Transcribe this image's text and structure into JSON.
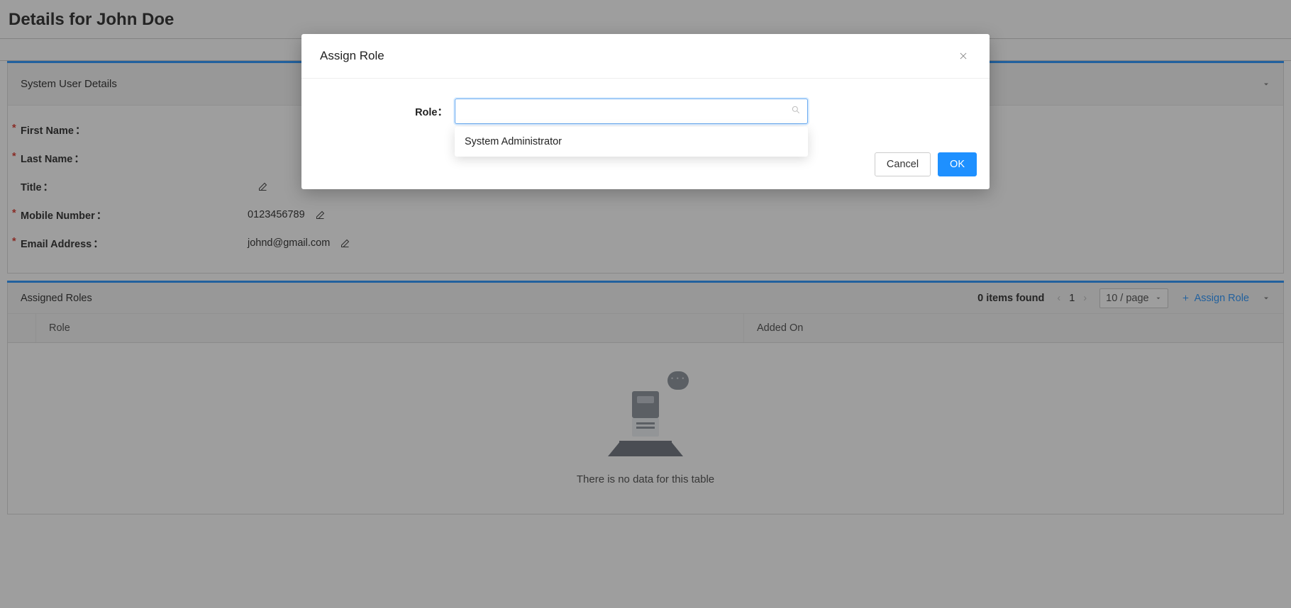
{
  "page": {
    "title": "Details for John Doe"
  },
  "details_panel": {
    "header": "System User Details",
    "fields": {
      "first_name": {
        "label": "First Name",
        "value": ""
      },
      "last_name": {
        "label": "Last Name",
        "value": ""
      },
      "title": {
        "label": "Title",
        "value": ""
      },
      "mobile": {
        "label": "Mobile Number",
        "value": "0123456789"
      },
      "email": {
        "label": "Email Address",
        "value": "johnd@gmail.com"
      }
    }
  },
  "roles_panel": {
    "header": "Assigned Roles",
    "items_found": "0 items found",
    "page_current": "1",
    "page_size": "10 / page",
    "assign_link": "Assign Role",
    "columns": {
      "role": "Role",
      "added_on": "Added On"
    },
    "empty_text": "There is no data for this table"
  },
  "modal": {
    "title": "Assign Role",
    "field_label": "Role",
    "colon": "：",
    "search_value": "",
    "options": [
      "System Administrator"
    ],
    "cancel": "Cancel",
    "ok": "OK"
  },
  "glyphs": {
    "chevron_left": "‹",
    "chevron_right": "›"
  }
}
